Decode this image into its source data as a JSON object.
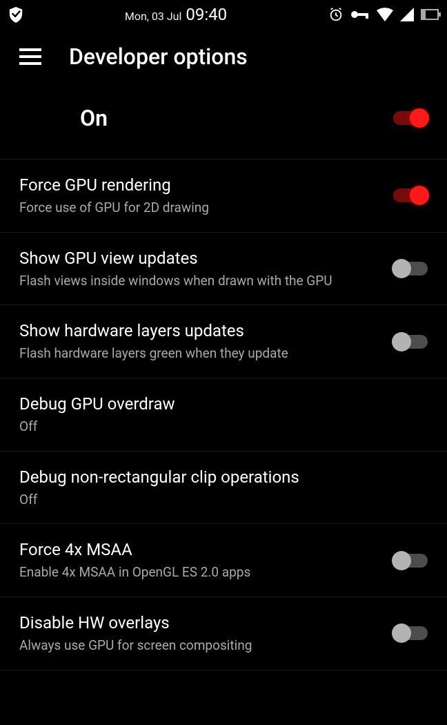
{
  "statusbar": {
    "date": "Mon, 03 Jul",
    "time": "09:40",
    "battery_pct": 22
  },
  "header": {
    "title": "Developer options"
  },
  "master": {
    "label": "On",
    "enabled": true
  },
  "settings": [
    {
      "title": "Force GPU rendering",
      "sub": "Force use of GPU for 2D drawing",
      "type": "switch",
      "enabled": true
    },
    {
      "title": "Show GPU view updates",
      "sub": "Flash views inside windows when drawn with the GPU",
      "type": "switch",
      "enabled": false
    },
    {
      "title": "Show hardware layers updates",
      "sub": "Flash hardware layers green when they update",
      "type": "switch",
      "enabled": false
    },
    {
      "title": "Debug GPU overdraw",
      "sub": "Off",
      "type": "select"
    },
    {
      "title": "Debug non-rectangular clip operations",
      "sub": "Off",
      "type": "select"
    },
    {
      "title": "Force 4x MSAA",
      "sub": "Enable 4x MSAA in OpenGL ES 2.0 apps",
      "type": "switch",
      "enabled": false
    },
    {
      "title": "Disable HW overlays",
      "sub": "Always use GPU for screen compositing",
      "type": "switch",
      "enabled": false
    }
  ]
}
